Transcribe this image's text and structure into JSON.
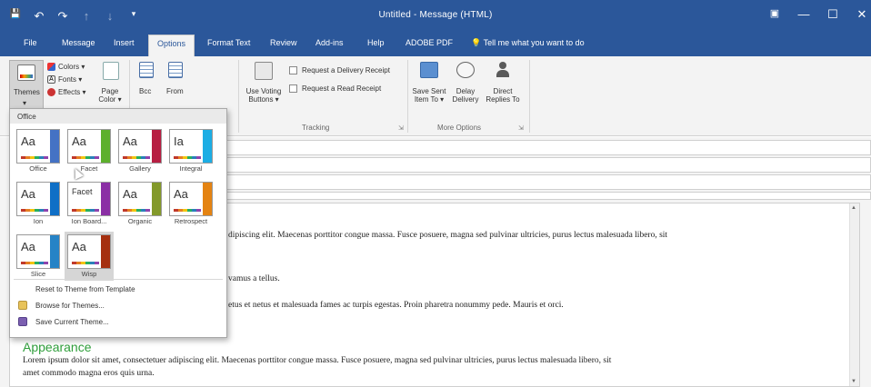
{
  "titlebar": {
    "title": "Untitled - Message (HTML)",
    "qat": [
      {
        "icon": "save-icon",
        "glyph": "💾"
      },
      {
        "icon": "undo-icon",
        "glyph": "↶"
      },
      {
        "icon": "redo-icon",
        "glyph": "↷"
      },
      {
        "icon": "up-arrow-icon",
        "glyph": "↑"
      },
      {
        "icon": "down-arrow-icon",
        "glyph": "↓"
      },
      {
        "icon": "customize-qat-icon",
        "glyph": "▾"
      }
    ],
    "controls": {
      "ribbon_display": "▣",
      "minimize": "—",
      "maximize": "☐",
      "close": "✕"
    }
  },
  "tabs": [
    "File",
    "Message",
    "Insert",
    "Options",
    "Format Text",
    "Review",
    "Add-ins",
    "Help",
    "ADOBE PDF",
    "Tell me what you want to do"
  ],
  "active_tab": "Options",
  "ribbon": {
    "themes": {
      "label": "Themes",
      "colors": "Colors ▾",
      "fonts": "Fonts ▾",
      "effects": "Effects ▾",
      "page_color": "Page Color ▾"
    },
    "show_fields": {
      "bcc": "Bcc",
      "from": "From"
    },
    "tracking": {
      "group_label": "Tracking",
      "use_voting": "Use Voting Buttons ▾",
      "delivery_receipt": "Request a Delivery Receipt",
      "read_receipt": "Request a Read Receipt"
    },
    "more_options": {
      "group_label": "More Options",
      "save_sent": "Save Sent Item To ▾",
      "delay": "Delay Delivery",
      "direct": "Direct Replies To"
    }
  },
  "gallery": {
    "header": "Office",
    "themes": [
      {
        "name": "Office",
        "accent": "#4472c4",
        "aa": "Aa"
      },
      {
        "name": "Facet",
        "accent": "#5db02c",
        "aa": "Aa"
      },
      {
        "name": "Gallery",
        "accent": "#b71e42",
        "aa": "Aa"
      },
      {
        "name": "Integral",
        "accent": "#1cade4",
        "aa": "Ia"
      },
      {
        "name": "Ion",
        "accent": "#0f6fc6",
        "aa": "Aa"
      },
      {
        "name": "Ion Board...",
        "accent": "#8b2fa5",
        "aa": "Facet"
      },
      {
        "name": "Organic",
        "accent": "#83992a",
        "aa": "Aa"
      },
      {
        "name": "Retrospect",
        "accent": "#e48312",
        "aa": "Aa"
      },
      {
        "name": "Slice",
        "accent": "#2683c6",
        "aa": "Aa"
      },
      {
        "name": "Wisp",
        "accent": "#a53010",
        "aa": "Aa"
      }
    ],
    "selected": "Wisp",
    "menu": {
      "reset": "Reset to Theme from Template",
      "browse": "Browse for Themes...",
      "save": "Save Current Theme..."
    }
  },
  "body": {
    "line1": "dipiscing elit. Maecenas porttitor congue massa. Fusce posuere, magna sed pulvinar ultricies, purus lectus malesuada libero, sit",
    "line2": "vamus a tellus.",
    "line3": "etus et netus et malesuada fames ac turpis egestas. Proin pharetra nonummy pede. Mauris et orci.",
    "heading": "Appearance",
    "para1": "Lorem ipsum dolor sit amet, consectetuer adipiscing elit. Maecenas porttitor congue massa. Fusce posuere, magna sed pulvinar ultricies, purus lectus malesuada libero, sit",
    "para2": "amet commodo magna eros quis urna."
  },
  "colors": {
    "brand": "#2b579a",
    "heading_green": "#2e9e3a"
  }
}
